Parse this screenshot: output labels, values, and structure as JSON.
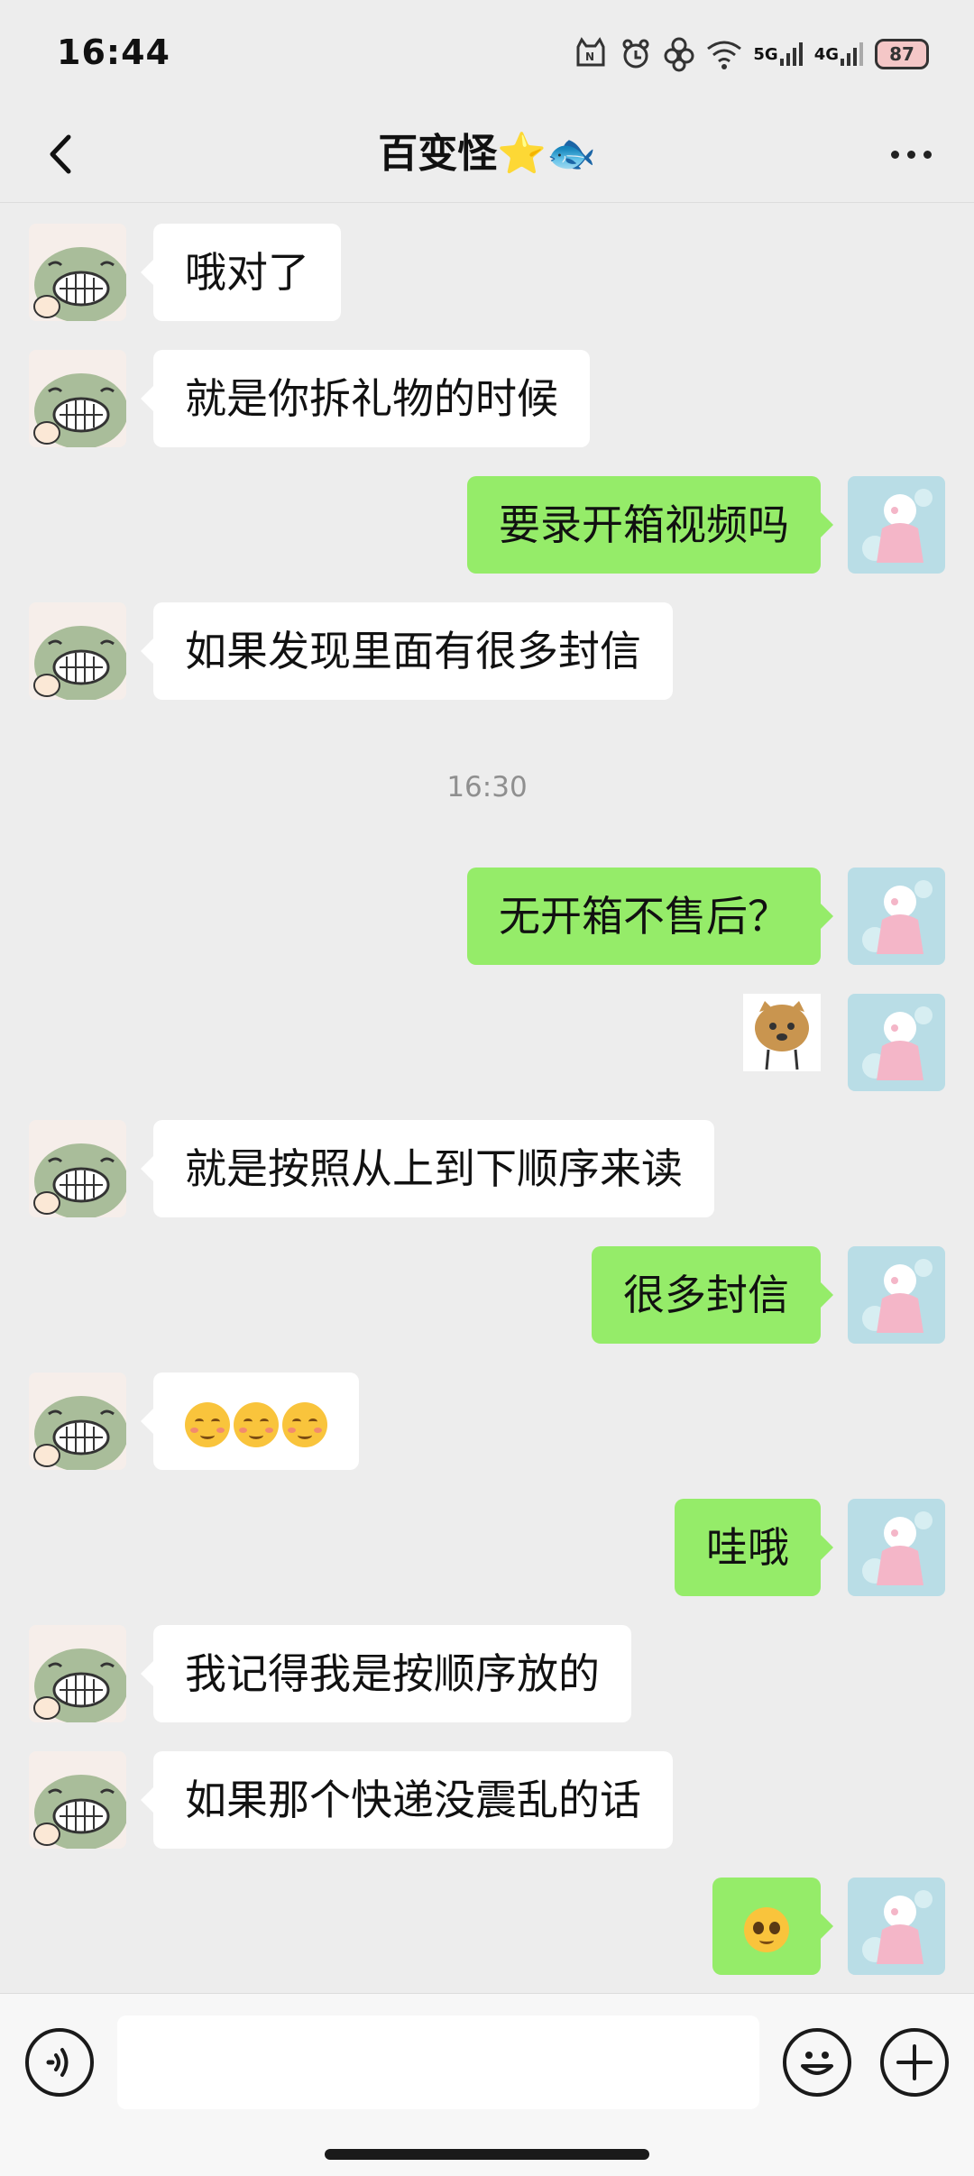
{
  "status_bar": {
    "time": "16:44",
    "network_1": "5G",
    "network_2": "4G",
    "battery": "87",
    "icons": [
      "cat-notification-icon",
      "paw-app-icon",
      "flower-app-icon",
      "wifi-icon",
      "signal-5g-icon",
      "signal-4g-icon",
      "battery-icon"
    ]
  },
  "header": {
    "title": "百变怪⭐🐟",
    "back_icon": "chevron-left-icon",
    "more_icon": "more-dots-icon"
  },
  "messages": [
    {
      "side": "left",
      "text": "哦对了"
    },
    {
      "side": "left",
      "text": "就是你拆礼物的时候"
    },
    {
      "side": "right",
      "text": "要录开箱视频吗"
    },
    {
      "side": "left",
      "text": "如果发现里面有很多封信"
    },
    {
      "side": "right",
      "text": "无开箱不售后？"
    },
    {
      "side": "right",
      "type": "sticker",
      "sticker": "cat-sticker"
    },
    {
      "side": "left",
      "text": "就是按照从上到下顺序来读"
    },
    {
      "side": "right",
      "text": "很多封信"
    },
    {
      "side": "left",
      "type": "emoji",
      "emoji": [
        "grimacing-blush-emoji",
        "grimacing-blush-emoji",
        "grimacing-blush-emoji"
      ]
    },
    {
      "side": "right",
      "text": "哇哦"
    },
    {
      "side": "left",
      "text": "我记得我是按顺序放的"
    },
    {
      "side": "left",
      "text": "如果那个快递没震乱的话"
    },
    {
      "side": "right",
      "type": "emoji",
      "emoji": [
        "pleading-face-emoji"
      ]
    }
  ],
  "timestamp": "16:30",
  "input_bar": {
    "voice_icon": "voice-icon",
    "input_value": "",
    "emoji_icon": "emoji-icon",
    "plus_icon": "plus-icon"
  },
  "colors": {
    "background": "#ededed",
    "sent_bubble": "#95ec69",
    "received_bubble": "#ffffff",
    "timestamp_text": "#8f8f8f"
  }
}
